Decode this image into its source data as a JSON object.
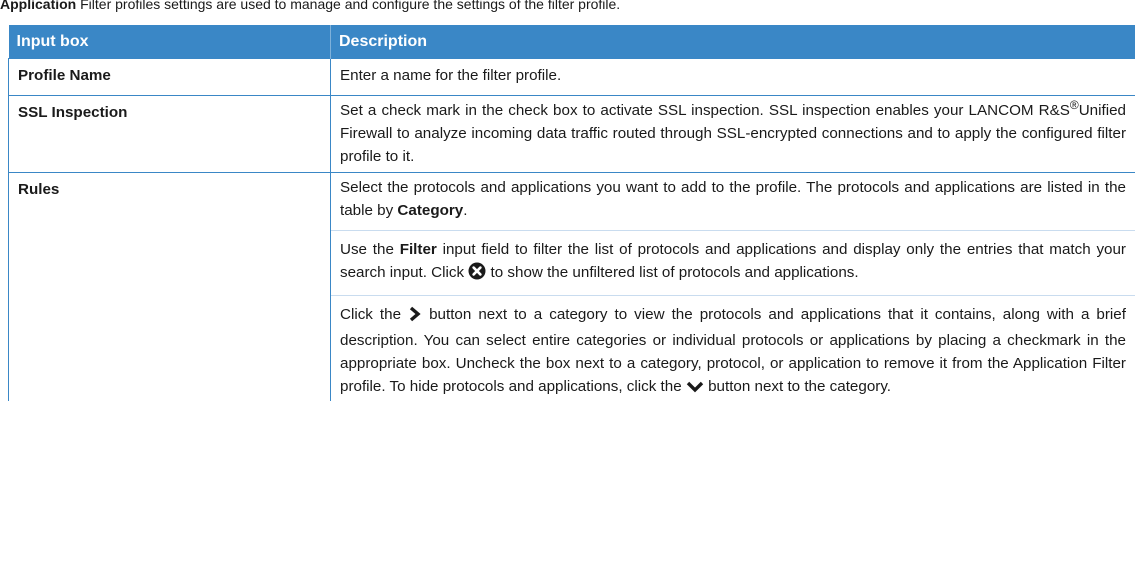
{
  "caption": {
    "bold": "Application",
    "rest": "Filter profiles settings are used to manage and configure the settings of the filter profile."
  },
  "table": {
    "headers": [
      "Input box",
      "Description"
    ],
    "rows": [
      {
        "label": "Profile Name",
        "text": "Enter a name for the filter profile."
      },
      {
        "label": "SSL Inspection",
        "text_before_mark": "Set a check mark in the check box to activate SSL inspection. SSL inspection enables your LANCOM R&S",
        "mark": "®",
        "text_after_mark": "Unified Firewall to analyze incoming data traffic routed through SSL-encrypted connections and to apply the configured filter profile to it."
      },
      {
        "label": "Rules",
        "p1_a": "Select the protocols and applications you want to add to the profile. The protocols and applications are listed in the table by ",
        "p1_bold": "Category",
        "p1_b": ".",
        "p2_a": "Use the ",
        "p2_bold": "Filter",
        "p2_b": " input field to filter the list of protocols and applications and display only the entries that match your search input. Click ",
        "p2_c": " to show the unfiltered list of protocols and applications.",
        "p3_a": "Click the ",
        "p3_b": " button next to a category to view the protocols and applications that it contains, along with a brief description. You can select entire categories or individual protocols or applications by placing a checkmark in the appropriate box. Uncheck the box next to a category, protocol, or application to remove it from the Application Filter profile. To hide protocols and applications, click the ",
        "p3_c": " button next to the category."
      }
    ]
  },
  "icons": {
    "clear": "clear-filter-icon",
    "expand": "chevron-right-icon",
    "collapse": "chevron-down-icon"
  }
}
